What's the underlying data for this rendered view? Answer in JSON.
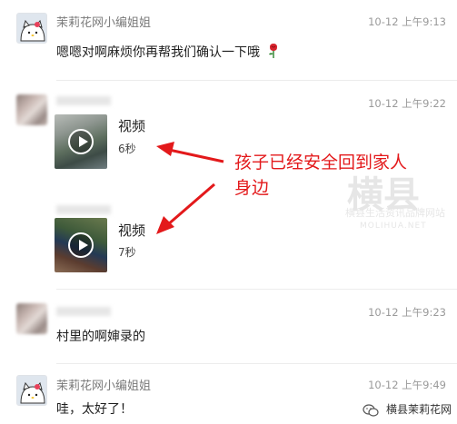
{
  "messages": [
    {
      "sender": "茉莉花网小编姐姐",
      "time": "10-12 上午9:13",
      "text": "嗯嗯对啊麻烦你再帮我们确认一下哦"
    },
    {
      "sender": "",
      "time": "10-12 上午9:22",
      "videos": [
        {
          "label": "视频",
          "duration": "6秒"
        },
        {
          "label": "视频",
          "duration": "7秒"
        }
      ]
    },
    {
      "sender": "",
      "time": "10-12 上午9:23",
      "text": "村里的啊婶录的"
    },
    {
      "sender": "茉莉花网小编姐姐",
      "time": "10-12 上午9:49",
      "text": "哇，太好了！"
    }
  ],
  "annotation": {
    "line1": "孩子已经安全回到家人",
    "line2": "身边"
  },
  "watermark": {
    "big": "横县",
    "sub": "横县生活资讯品牌网站",
    "en": "MOLIHUA.NET"
  },
  "brand": {
    "name": "横县茉莉花网"
  },
  "colors": {
    "annotation": "#e3191b"
  }
}
